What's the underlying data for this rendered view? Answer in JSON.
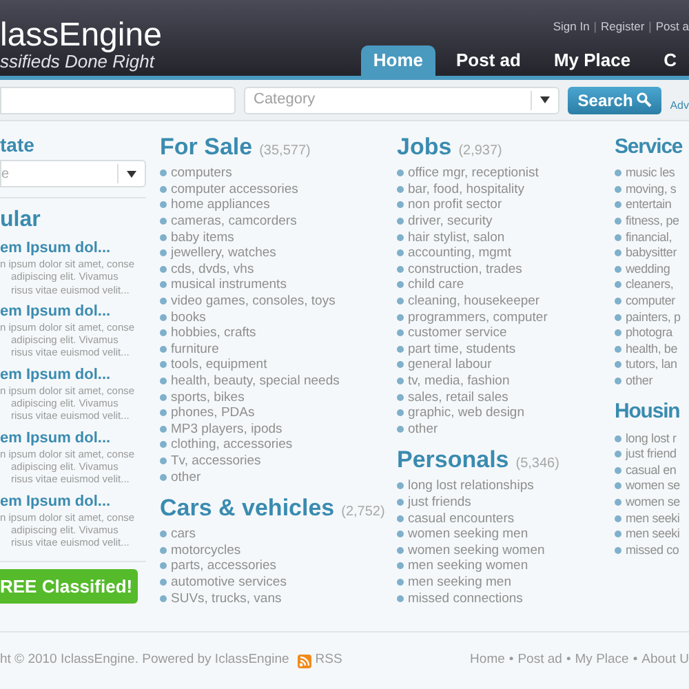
{
  "header": {
    "logo": "lassEngine",
    "tagline": "ssifieds Done Right",
    "top_links": [
      "Sign In",
      "Register",
      "Post a"
    ],
    "link_separator": "|",
    "tabs": [
      {
        "label": "Home",
        "selected": true
      },
      {
        "label": "Post ad",
        "selected": false
      },
      {
        "label": "My Place",
        "selected": false
      },
      {
        "label": "C",
        "selected": false
      }
    ]
  },
  "search": {
    "category_placeholder": "Category",
    "button": "Search",
    "advanced_link": "Adv"
  },
  "sidebar": {
    "state_title": "tate",
    "state_value": "e",
    "popular_title": "ular",
    "posts": [
      {
        "title": "em Ipsum dol...",
        "lines": [
          "n ipsum dolor sit amet, conse",
          "adipiscing elit. Vivamus",
          "risus vitae euismod velit..."
        ]
      },
      {
        "title": "em Ipsum dol...",
        "lines": [
          "n ipsum dolor sit amet, conse",
          "adipiscing elit. Vivamus",
          "risus vitae euismod velit..."
        ]
      },
      {
        "title": "em Ipsum dol...",
        "lines": [
          "n ipsum dolor sit amet, conse",
          "adipiscing elit. Vivamus",
          "risus vitae euismod velit..."
        ]
      },
      {
        "title": "em Ipsum dol...",
        "lines": [
          "n ipsum dolor sit amet, conse",
          "adipiscing elit. Vivamus",
          "risus vitae euismod velit..."
        ]
      },
      {
        "title": "em Ipsum dol...",
        "lines": [
          "n ipsum dolor sit amet, conse",
          "adipiscing elit. Vivamus",
          "risus vitae euismod velit..."
        ]
      }
    ],
    "post_button": "REE Classified!"
  },
  "category_columns": [
    [
      {
        "title": "For Sale",
        "count": "(35,577)",
        "items": [
          "computers",
          "computer accessories",
          "home appliances",
          "cameras, camcorders",
          "baby items",
          "jewellery, watches",
          "cds, dvds, vhs",
          "musical instruments",
          "video games, consoles, toys",
          "books",
          "hobbies, crafts",
          "furniture",
          "tools, equipment",
          "health, beauty, special needs",
          "sports, bikes",
          "phones, PDAs",
          "MP3 players, ipods",
          "clothing, accessories",
          "Tv, accessories",
          "other"
        ]
      },
      {
        "title": "Cars & vehicles",
        "count": "(2,752)",
        "items": [
          "cars",
          "motorcycles",
          "parts, accessories",
          "automotive services",
          "SUVs, trucks, vans"
        ]
      }
    ],
    [
      {
        "title": "Jobs",
        "count": "(2,937)",
        "items": [
          "office mgr, receptionist",
          "bar, food, hospitality",
          "non profit sector",
          "driver, security",
          "hair stylist, salon",
          "accounting, mgmt",
          "construction, trades",
          "child care",
          "cleaning, housekeeper",
          "programmers, computer",
          "customer service",
          "part time, students",
          "general labour",
          "tv, media, fashion",
          "sales, retail sales",
          "graphic, web design",
          "other"
        ]
      },
      {
        "title": "Personals",
        "count": "(5,346)",
        "items": [
          "long lost relationships",
          "just friends",
          "casual encounters",
          "women seeking men",
          "women seeking women",
          "men seeking women",
          "men seeking men",
          "missed connections"
        ]
      }
    ],
    [
      {
        "title": "Service",
        "items": [
          "music les",
          "moving, s",
          "entertain",
          "fitness, pe",
          "financial,",
          "babysitter",
          "wedding",
          "cleaners,",
          "computer",
          "painters, p",
          "photogra",
          "health, be",
          "tutors, lan",
          "other"
        ]
      },
      {
        "title": "Housin",
        "items": [
          "long lost r",
          "just friend",
          "casual en",
          "women se",
          "women se",
          "men seeki",
          "men seeki",
          "missed co"
        ]
      }
    ]
  ],
  "footer": {
    "copyright": "ht © 2010 IclassEngine. Powered by IclassEngine",
    "rss": "RSS",
    "separator": "•",
    "links": [
      "Home",
      "Post ad",
      "My Place",
      "About U"
    ]
  }
}
